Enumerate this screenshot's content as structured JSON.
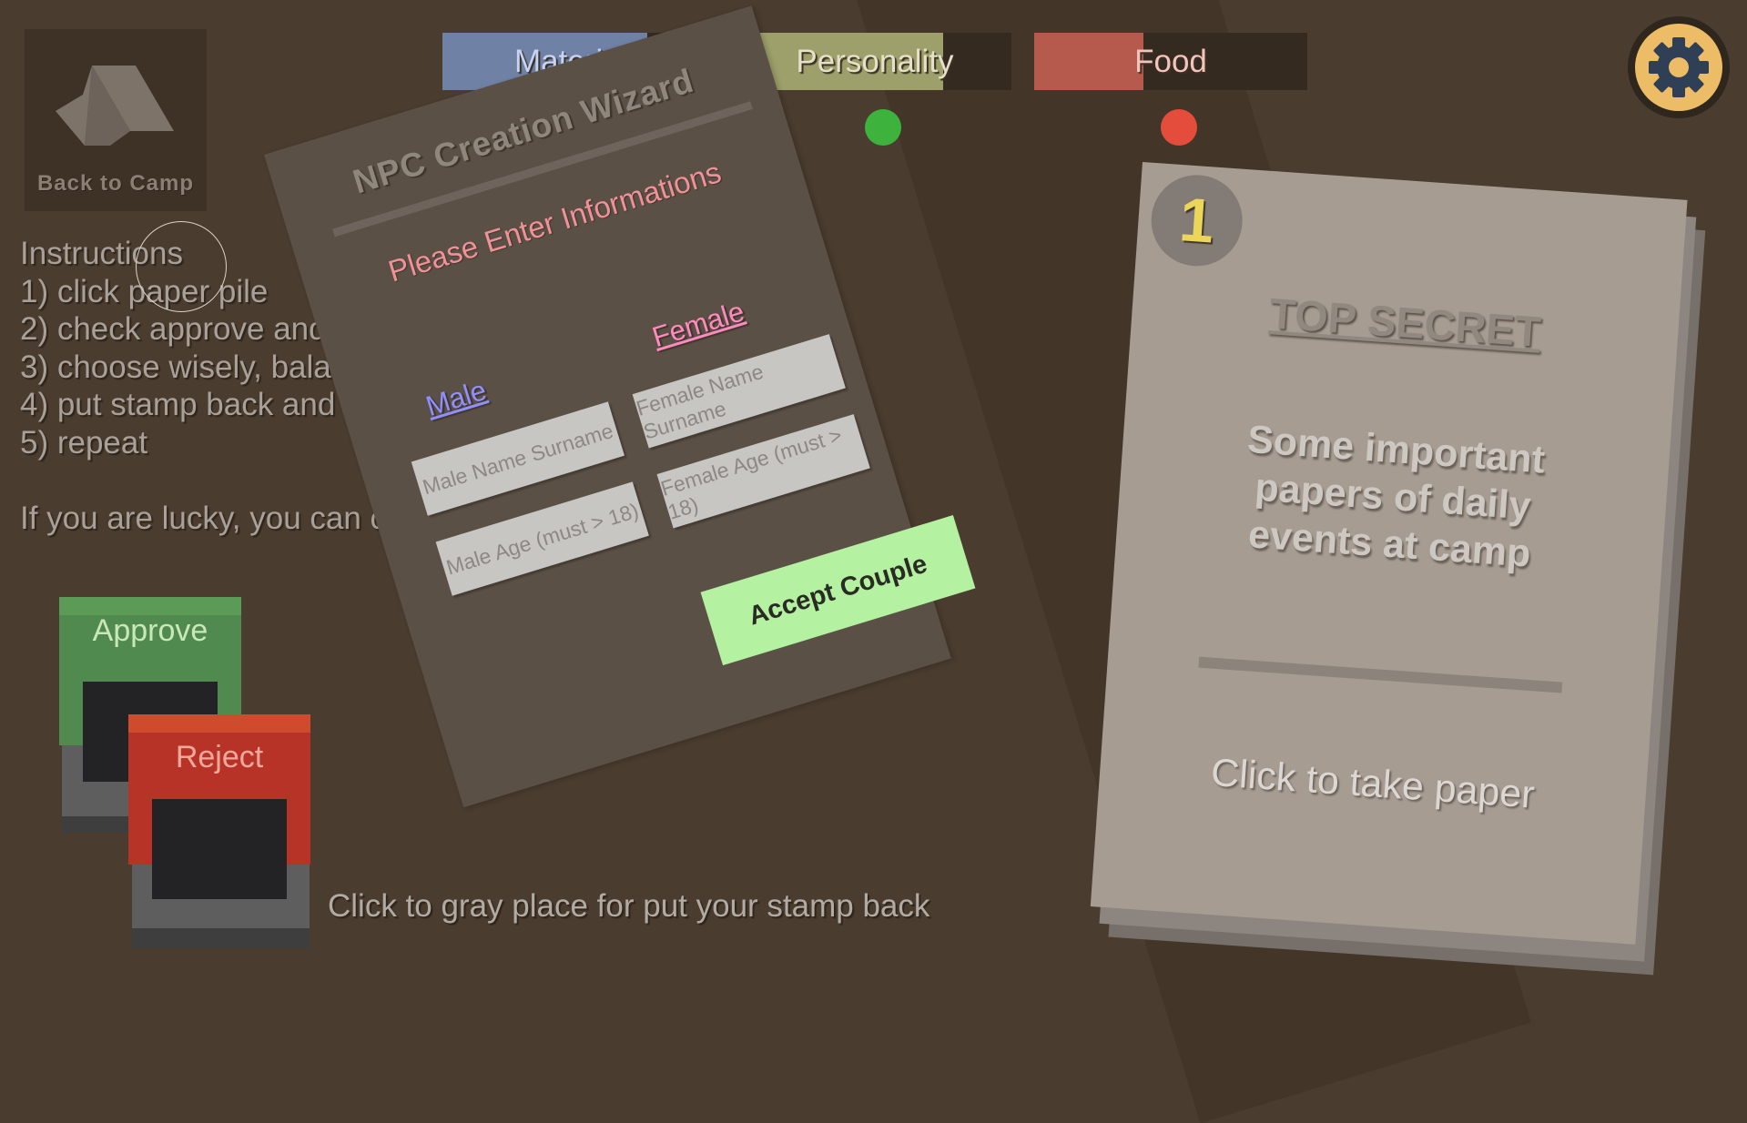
{
  "camp": {
    "label": "Back to Camp",
    "icon": "tent-icon"
  },
  "stats": [
    {
      "label": "Materials",
      "fill_fraction": 0.75,
      "color": "#6f82a6",
      "text_color": "#c7d3f2"
    },
    {
      "label": "Personality",
      "fill_fraction": 0.75,
      "color": "#9da06a",
      "text_color": "#e4e1c8"
    },
    {
      "label": "Food",
      "fill_fraction": 0.4,
      "color": "#b65a4e",
      "text_color": "#f4c4bc"
    }
  ],
  "indicators": {
    "personality_color": "#3db23d",
    "food_color": "#e44c3c"
  },
  "settings": {
    "icon": "gear-icon"
  },
  "instructions": {
    "lines": [
      "Instructions",
      "1) click paper pile",
      "2) check approve and reject affects",
      "3) choose wisely, balance your stats",
      "4) put stamp back and click paper to send",
      "5) repeat",
      "",
      "If you are lucky, you can create new NPCs"
    ]
  },
  "stamps": {
    "approve_label": "Approve",
    "reject_label": "Reject"
  },
  "wizard": {
    "title": "NPC Creation Wizard",
    "prompt": "Please Enter Informations",
    "male_label": "Male",
    "female_label": "Female",
    "male_name_placeholder": "Male Name Surname",
    "male_age_placeholder": "Male Age (must > 18)",
    "female_name_placeholder": "Female Name Surname",
    "female_age_placeholder": "Female Age (must > 18)",
    "accept_label": "Accept Couple"
  },
  "paper_pile": {
    "count": "1",
    "heading": "TOP SECRET",
    "description": "Some important papers of daily events at camp",
    "action": "Click to take paper"
  },
  "hint": "Click to gray place for put your stamp back"
}
